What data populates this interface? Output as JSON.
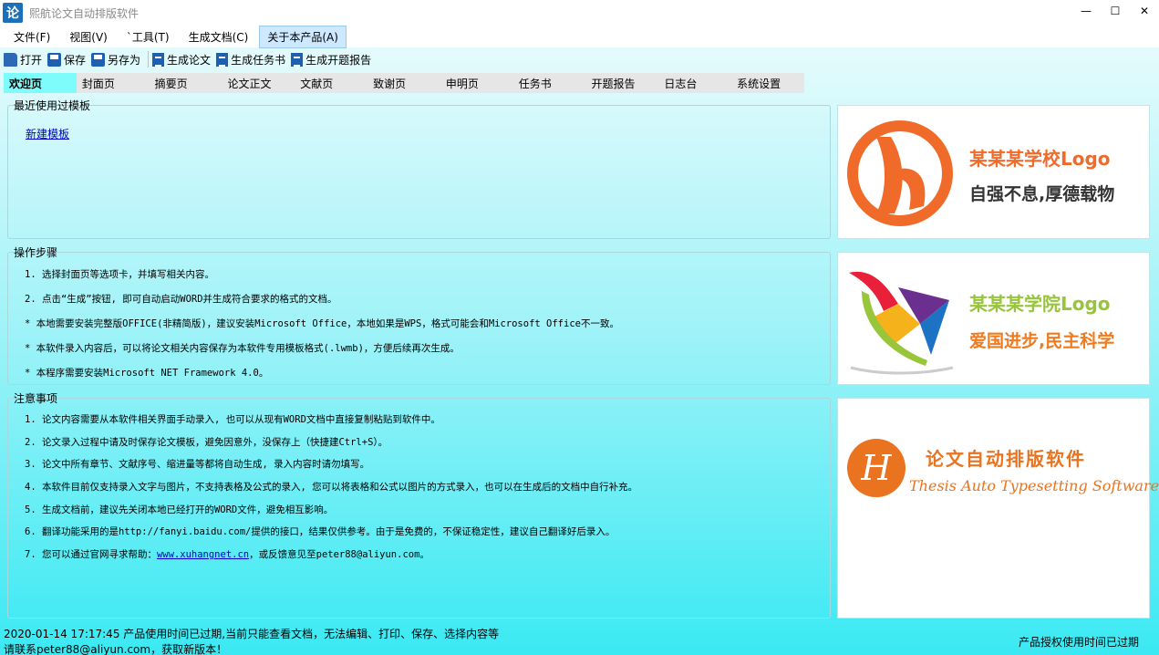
{
  "window": {
    "icon_char": "论",
    "title": "熙航论文自动排版软件",
    "min_glyph": "—",
    "max_glyph": "☐",
    "close_glyph": "✕"
  },
  "menu": [
    "文件(F)",
    "视图(V)",
    "`工具(T)",
    "生成文档(C)",
    "关于本产品(A)"
  ],
  "toolbar": {
    "open": "打开",
    "save": "保存",
    "save_as": "另存为",
    "gen_thesis": "生成论文",
    "gen_task": "生成任务书",
    "gen_proposal": "生成开题报告"
  },
  "tabs": [
    "欢迎页",
    "封面页",
    "摘要页",
    "论文正文",
    "文献页",
    "致谢页",
    "申明页",
    "任务书",
    "开题报告",
    "日志台",
    "系统设置"
  ],
  "recent": {
    "legend": "最近使用过模板",
    "new_template": "新建模板"
  },
  "steps": {
    "legend": "操作步骤",
    "items": [
      "1. 选择封面页等选项卡，并填写相关内容。",
      "2. 点击“生成”按钮, 即可自动启动WORD并生成符合要求的格式的文档。",
      "* 本地需要安装完整版OFFICE(非精简版)，建议安装Microsoft Office，本地如果是WPS，格式可能会和Microsoft Office不一致。",
      "* 本软件录入内容后，可以将论文相关内容保存为本软件专用模板格式(.lwmb)，方便后续再次生成。",
      "* 本程序需要安装Microsoft NET Framework 4.0。"
    ]
  },
  "notes": {
    "legend": "注意事项",
    "items": [
      "1. 论文内容需要从本软件相关界面手动录入, 也可以从现有WORD文档中直接复制粘贴到软件中。",
      "2. 论文录入过程中请及时保存论文模板，避免因意外，没保存上（快捷建Ctrl+S）。",
      "3. 论文中所有章节、文献序号、缩进量等都将自动生成, 录入内容时请勿填写。",
      "4. 本软件目前仅支持录入文字与图片，不支持表格及公式的录入, 您可以将表格和公式以图片的方式录入，也可以在生成后的文档中自行补充。",
      "5. 生成文档前，建议先关闭本地已经打开的WORD文件，避免相互影响。",
      "6. 翻译功能采用的是http://fanyi.baidu.com/提供的接口，结果仅供参考。由于是免费的，不保证稳定性，建议自己翻译好后录入。"
    ],
    "last_prefix": "7. 您可以通过官网寻求帮助：",
    "last_link": "www.xuhangnet.cn",
    "last_suffix": "，或反馈意见至peter88@aliyun.com。"
  },
  "logos": {
    "school_name": "某某某学校Logo",
    "school_motto": "自强不息,厚德载物",
    "college_name": "某某某学院Logo",
    "college_motto": "爱国进步,民主科学",
    "software_letter": "H",
    "software_cn": "论文自动排版软件",
    "software_en": "Thesis Auto Typesetting Software"
  },
  "status": {
    "line1": "2020-01-14 17:17:45  产品使用时间已过期,当前只能查看文档，无法编辑、打印、保存、选择内容等",
    "line2": "请联系peter88@aliyun.com，获取新版本！",
    "right": "产品授权使用时间已过期"
  },
  "colors": {
    "active_tab": "#7dfcfb",
    "link": "#0000cc",
    "school_logo": "#f06a2a",
    "college_green": "#98c43c",
    "software_orange": "#e9731f"
  }
}
